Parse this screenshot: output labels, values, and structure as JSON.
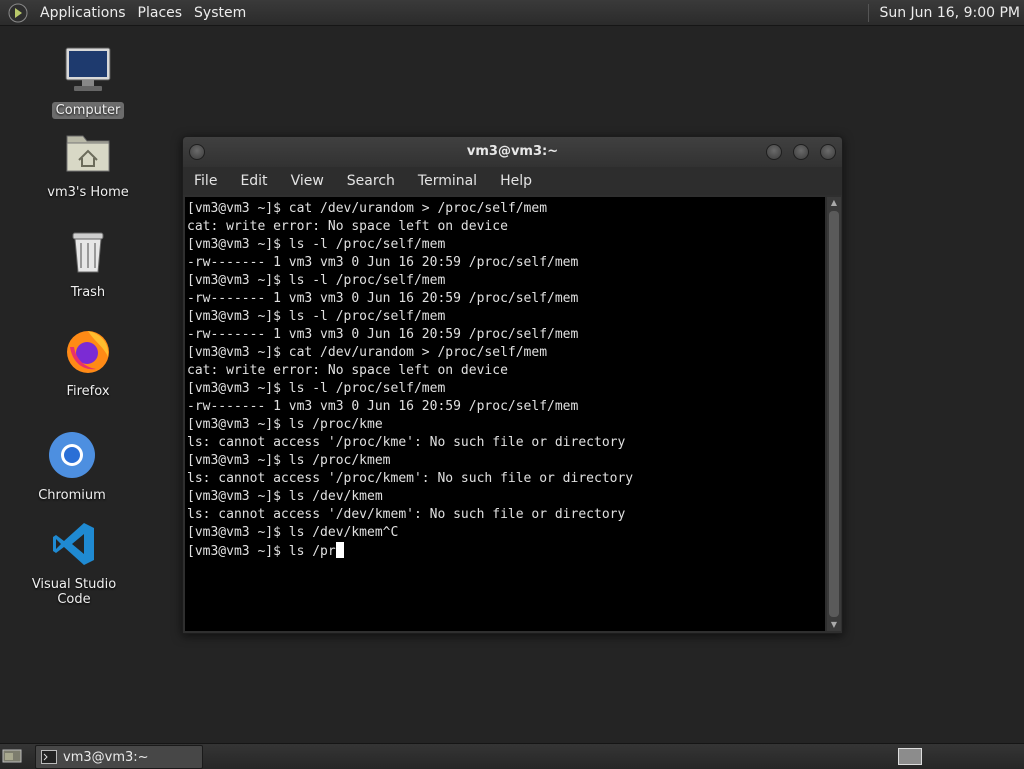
{
  "top_panel": {
    "menus": [
      "Applications",
      "Places",
      "System"
    ],
    "clock": "Sun Jun 16,  9:00 PM"
  },
  "desktop_icons": [
    {
      "label": "Computer",
      "icon": "computer-icon"
    },
    {
      "label": "vm3's Home",
      "icon": "home-folder-icon"
    },
    {
      "label": "Trash",
      "icon": "trash-icon"
    },
    {
      "label": "Firefox",
      "icon": "firefox-icon"
    },
    {
      "label": "Chromium",
      "icon": "chromium-icon"
    },
    {
      "label": "Visual Studio Code",
      "icon": "vscode-icon"
    }
  ],
  "terminal": {
    "title": "vm3@vm3:~",
    "menu": [
      "File",
      "Edit",
      "View",
      "Search",
      "Terminal",
      "Help"
    ],
    "lines": [
      "[vm3@vm3 ~]$ cat /dev/urandom > /proc/self/mem",
      "cat: write error: No space left on device",
      "[vm3@vm3 ~]$ ls -l /proc/self/mem",
      "-rw------- 1 vm3 vm3 0 Jun 16 20:59 /proc/self/mem",
      "[vm3@vm3 ~]$ ls -l /proc/self/mem",
      "-rw------- 1 vm3 vm3 0 Jun 16 20:59 /proc/self/mem",
      "[vm3@vm3 ~]$ ls -l /proc/self/mem",
      "-rw------- 1 vm3 vm3 0 Jun 16 20:59 /proc/self/mem",
      "[vm3@vm3 ~]$ cat /dev/urandom > /proc/self/mem",
      "cat: write error: No space left on device",
      "[vm3@vm3 ~]$ ls -l /proc/self/mem",
      "-rw------- 1 vm3 vm3 0 Jun 16 20:59 /proc/self/mem",
      "[vm3@vm3 ~]$ ls /proc/kme",
      "ls: cannot access '/proc/kme': No such file or directory",
      "[vm3@vm3 ~]$ ls /proc/kmem",
      "ls: cannot access '/proc/kmem': No such file or directory",
      "[vm3@vm3 ~]$ ls /dev/kmem",
      "ls: cannot access '/dev/kmem': No such file or directory",
      "[vm3@vm3 ~]$ ls /dev/kmem^C"
    ],
    "current_input": "[vm3@vm3 ~]$ ls /pr"
  },
  "taskbar": {
    "window_button": "vm3@vm3:~"
  }
}
